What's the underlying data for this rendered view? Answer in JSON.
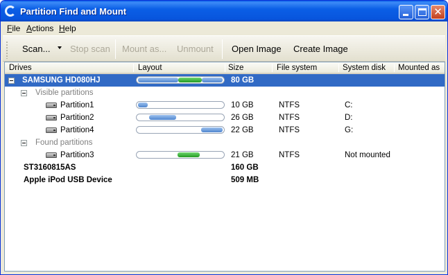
{
  "window": {
    "title": "Partition Find and Mount"
  },
  "menu": [
    {
      "label": "File",
      "accel": "F",
      "rest": "ile"
    },
    {
      "label": "Actions",
      "accel": "A",
      "rest": "ctions"
    },
    {
      "label": "Help",
      "accel": "H",
      "rest": "elp"
    }
  ],
  "toolbar": {
    "scan": "Scan...",
    "stop_scan": "Stop scan",
    "mount_as": "Mount as...",
    "unmount": "Unmount",
    "open_image": "Open Image",
    "create_image": "Create Image"
  },
  "columns": {
    "drives": "Drives",
    "layout": "Layout",
    "size": "Size",
    "file_system": "File system",
    "system_disk": "System disk",
    "mounted_as": "Mounted as"
  },
  "rows": {
    "disk1": {
      "name": "SAMSUNG HD080HJ",
      "size": "80 GB"
    },
    "visible_group": "Visible partitions",
    "p1": {
      "name": "Partition1",
      "size": "10 GB",
      "fs": "NTFS",
      "system_disk": "C:",
      "layout_start": 0.0,
      "layout_end": 0.13
    },
    "p2": {
      "name": "Partition2",
      "size": "26 GB",
      "fs": "NTFS",
      "system_disk": "D:",
      "layout_start": 0.13,
      "layout_end": 0.46
    },
    "p4": {
      "name": "Partition4",
      "size": "22 GB",
      "fs": "NTFS",
      "system_disk": "G:",
      "layout_start": 0.73,
      "layout_end": 1.0
    },
    "found_group": "Found partitions",
    "p3": {
      "name": "Partition3",
      "size": "21 GB",
      "fs": "NTFS",
      "system_disk": "Not mounted",
      "layout_start": 0.46,
      "layout_end": 0.73
    },
    "disk2": {
      "name": "ST3160815AS",
      "size": "160 GB"
    },
    "disk3": {
      "name": "Apple iPod USB Device",
      "size": "509 MB"
    }
  },
  "colors": {
    "selection": "#316ac5",
    "partition_blue": "#4f86cf",
    "partition_green": "#229a22"
  }
}
